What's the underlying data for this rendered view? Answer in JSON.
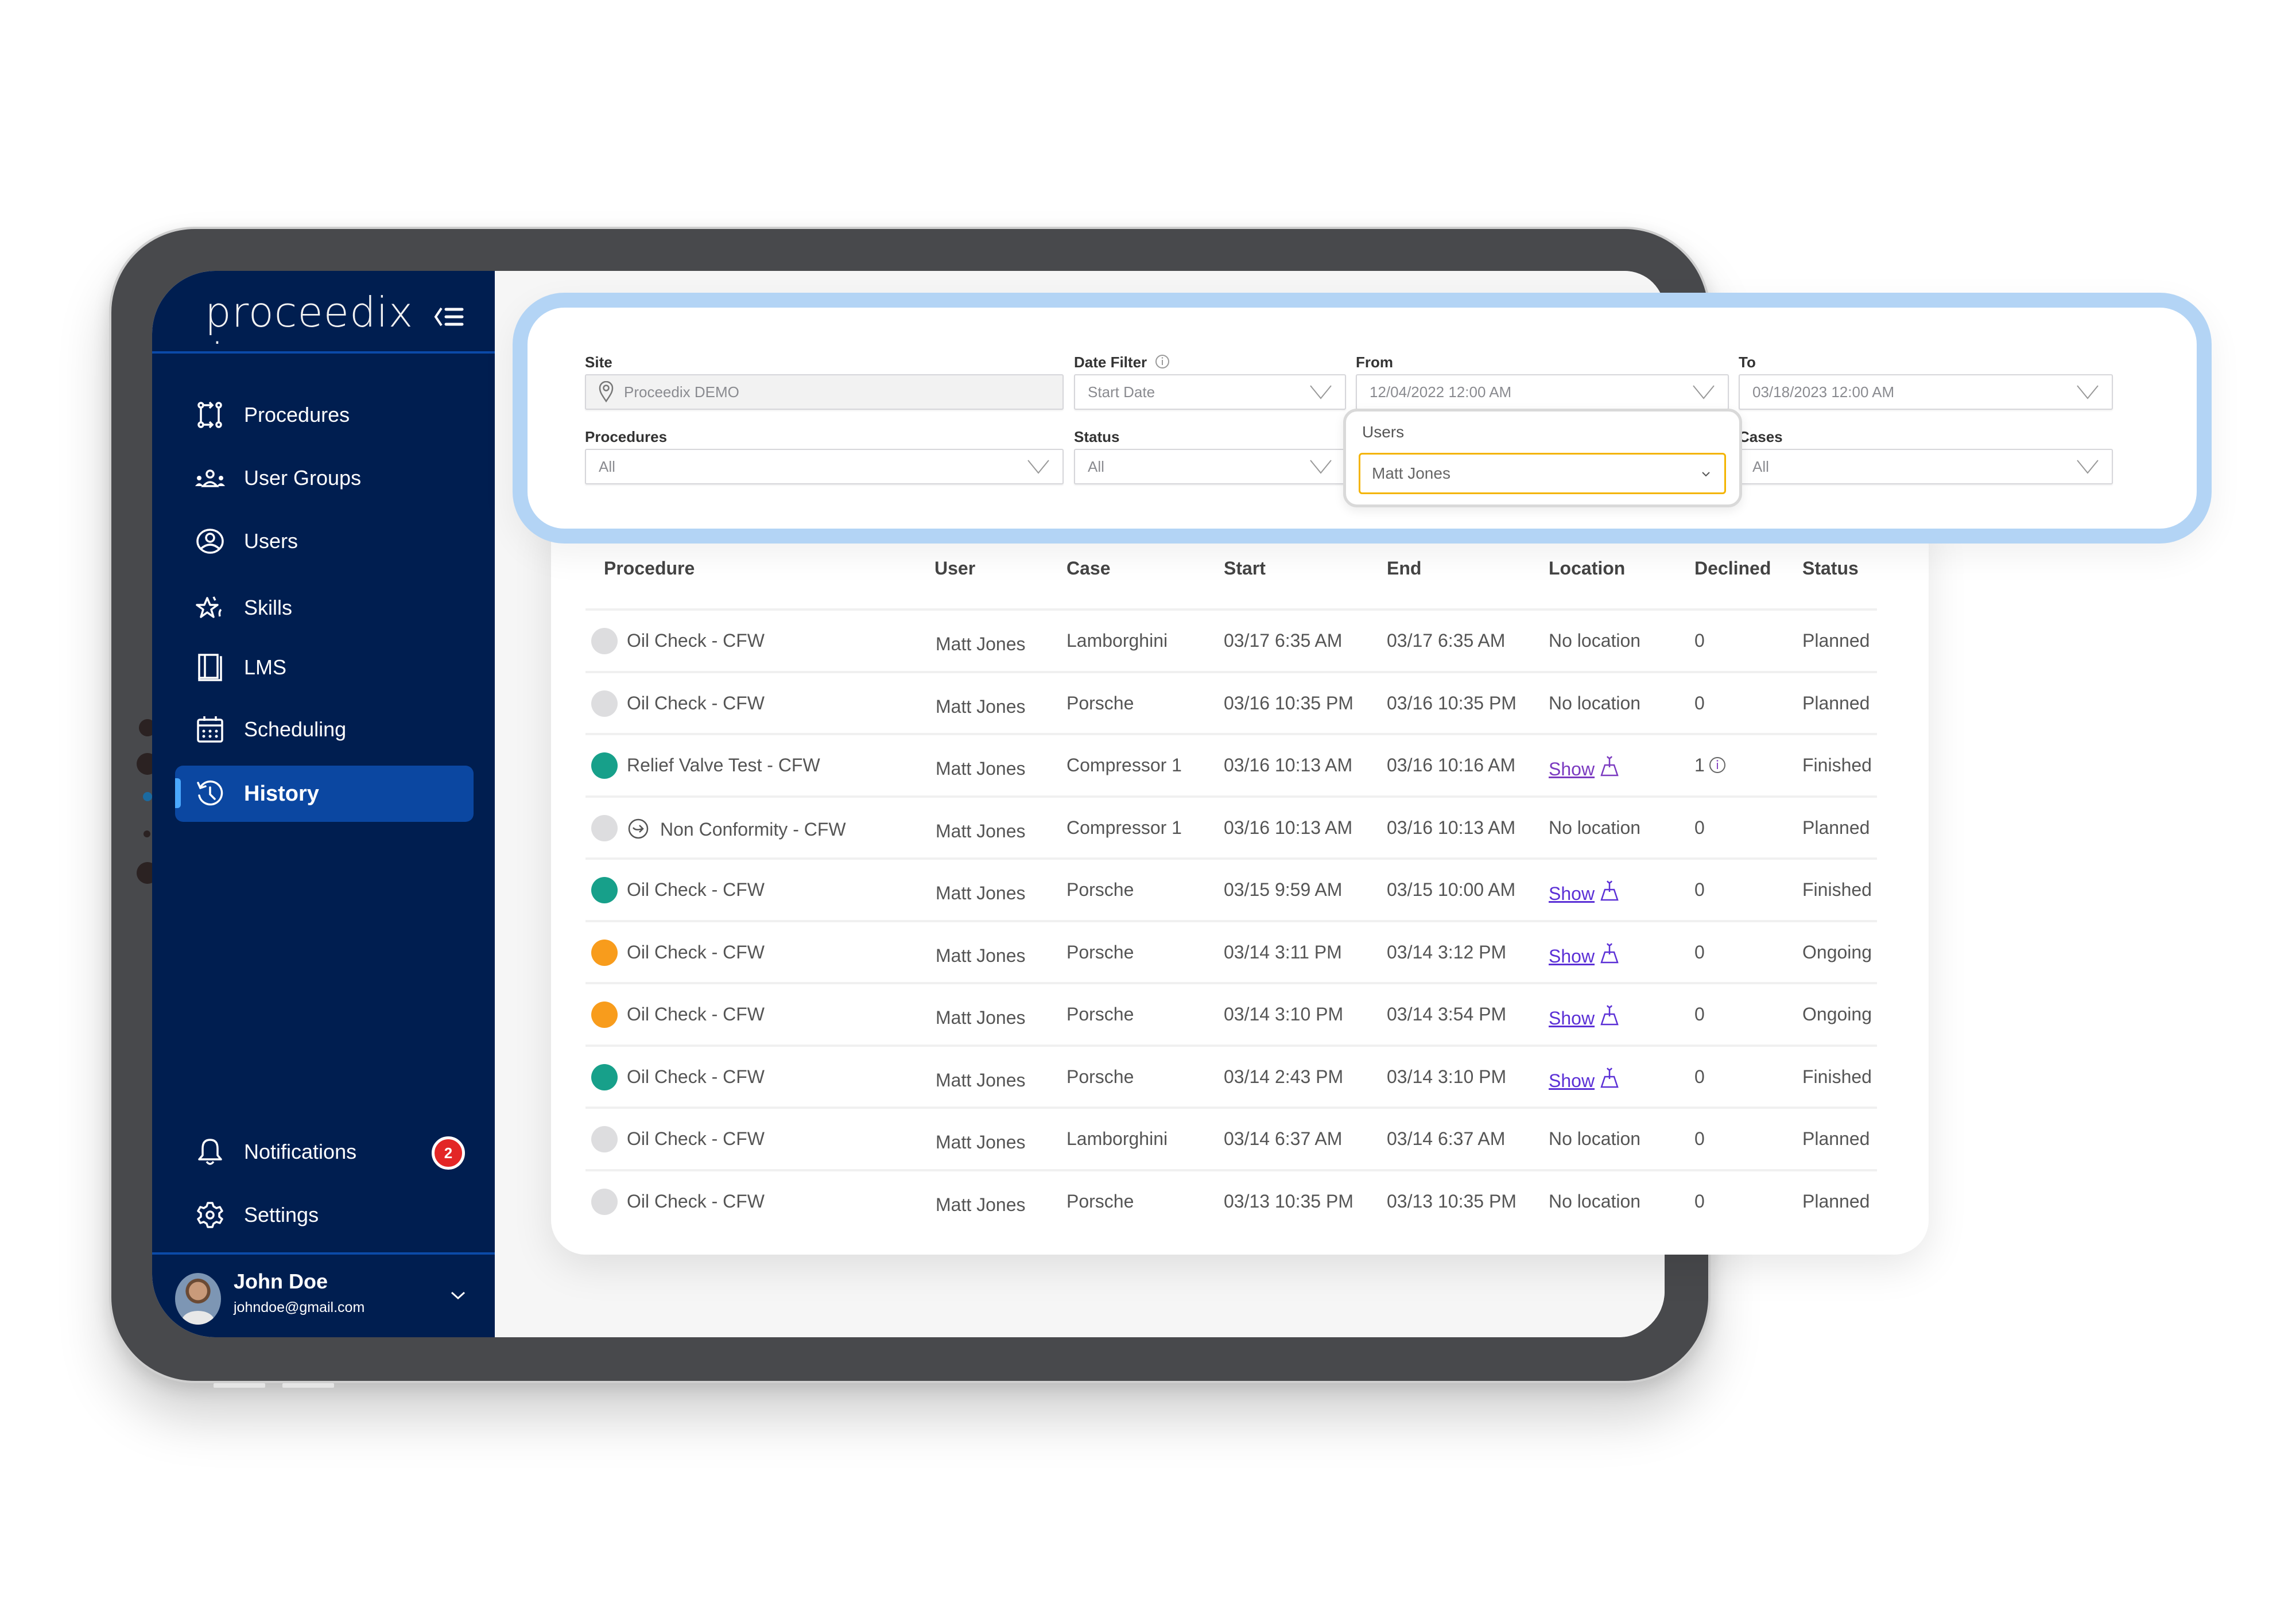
{
  "app": {
    "brand": "proceedix",
    "brand_dot": "."
  },
  "sidebar": {
    "items": [
      {
        "label": "Procedures",
        "icon": "procedures-flow-icon"
      },
      {
        "label": "User Groups",
        "icon": "user-groups-icon"
      },
      {
        "label": "Users",
        "icon": "user-circle-icon"
      },
      {
        "label": "Skills",
        "icon": "star-icon"
      },
      {
        "label": "LMS",
        "icon": "book-icon"
      },
      {
        "label": "Scheduling",
        "icon": "calendar-icon"
      },
      {
        "label": "History",
        "icon": "history-icon",
        "active": true
      }
    ],
    "bottom_items": [
      {
        "label": "Notifications",
        "icon": "bell-icon",
        "badge": "2"
      },
      {
        "label": "Settings",
        "icon": "gear-icon"
      }
    ],
    "user": {
      "name": "John Doe",
      "email": "johndoe@gmail.com"
    }
  },
  "filters": {
    "site": {
      "label": "Site",
      "value": "Proceedix DEMO"
    },
    "date_filter": {
      "label": "Date Filter",
      "value": "Start Date"
    },
    "from": {
      "label": "From",
      "value": "12/04/2022 12:00 AM"
    },
    "to": {
      "label": "To",
      "value": "03/18/2023 12:00 AM"
    },
    "procedures": {
      "label": "Procedures",
      "value": "All"
    },
    "status": {
      "label": "Status",
      "value": "All"
    },
    "users": {
      "label": "Users",
      "value": "Matt Jones"
    },
    "cases": {
      "label": "Cases",
      "value": "All"
    }
  },
  "table": {
    "columns": [
      "Procedure",
      "User",
      "Case",
      "Start",
      "End",
      "Location",
      "Declined",
      "Status"
    ],
    "status_colors": {
      "Planned": "#dddddf",
      "Finished": "#17a08a",
      "Ongoing": "#f89c1c"
    },
    "rows": [
      {
        "procedure": "Oil Check - CFW",
        "user": "Matt Jones",
        "case": "Lamborghini",
        "start": "03/17 6:35 AM",
        "end": "03/17 6:35 AM",
        "location": "No location",
        "declined": "0",
        "status": "Planned"
      },
      {
        "procedure": "Oil Check - CFW",
        "user": "Matt Jones",
        "case": "Porsche",
        "start": "03/16 10:35 PM",
        "end": "03/16 10:35 PM",
        "location": "No location",
        "declined": "0",
        "status": "Planned"
      },
      {
        "procedure": "Relief Valve Test - CFW",
        "user": "Matt Jones",
        "case": "Compressor 1",
        "start": "03/16 10:13 AM",
        "end": "03/16 10:16 AM",
        "location": "Show",
        "declined": "1",
        "declined_info": true,
        "status": "Finished"
      },
      {
        "procedure": "Non Conformity - CFW",
        "user": "Matt Jones",
        "case": "Compressor 1",
        "start": "03/16 10:13 AM",
        "end": "03/16 10:13 AM",
        "location": "No location",
        "declined": "0",
        "status": "Planned",
        "nonconformity": true
      },
      {
        "procedure": "Oil Check - CFW",
        "user": "Matt Jones",
        "case": "Porsche",
        "start": "03/15 9:59 AM",
        "end": "03/15 10:00 AM",
        "location": "Show",
        "declined": "0",
        "status": "Finished"
      },
      {
        "procedure": "Oil Check - CFW",
        "user": "Matt Jones",
        "case": "Porsche",
        "start": "03/14 3:11 PM",
        "end": "03/14 3:12 PM",
        "location": "Show",
        "declined": "0",
        "status": "Ongoing"
      },
      {
        "procedure": "Oil Check - CFW",
        "user": "Matt Jones",
        "case": "Porsche",
        "start": "03/14 3:10 PM",
        "end": "03/14 3:54 PM",
        "location": "Show",
        "declined": "0",
        "status": "Ongoing"
      },
      {
        "procedure": "Oil Check - CFW",
        "user": "Matt Jones",
        "case": "Porsche",
        "start": "03/14 2:43 PM",
        "end": "03/14 3:10 PM",
        "location": "Show",
        "declined": "0",
        "status": "Finished"
      },
      {
        "procedure": "Oil Check - CFW",
        "user": "Matt Jones",
        "case": "Lamborghini",
        "start": "03/14 6:37 AM",
        "end": "03/14 6:37 AM",
        "location": "No location",
        "declined": "0",
        "status": "Planned"
      },
      {
        "procedure": "Oil Check - CFW",
        "user": "Matt Jones",
        "case": "Porsche",
        "start": "03/13 10:35 PM",
        "end": "03/13 10:35 PM",
        "location": "No location",
        "declined": "0",
        "status": "Planned"
      }
    ]
  },
  "colors": {
    "sidebar_bg": "#001e50",
    "active_item_bg": "#0b47a1",
    "highlight_border": "#b3d4f5",
    "users_select_border": "#f4b400",
    "badge": "#e32626",
    "link": "#5b30d6"
  }
}
